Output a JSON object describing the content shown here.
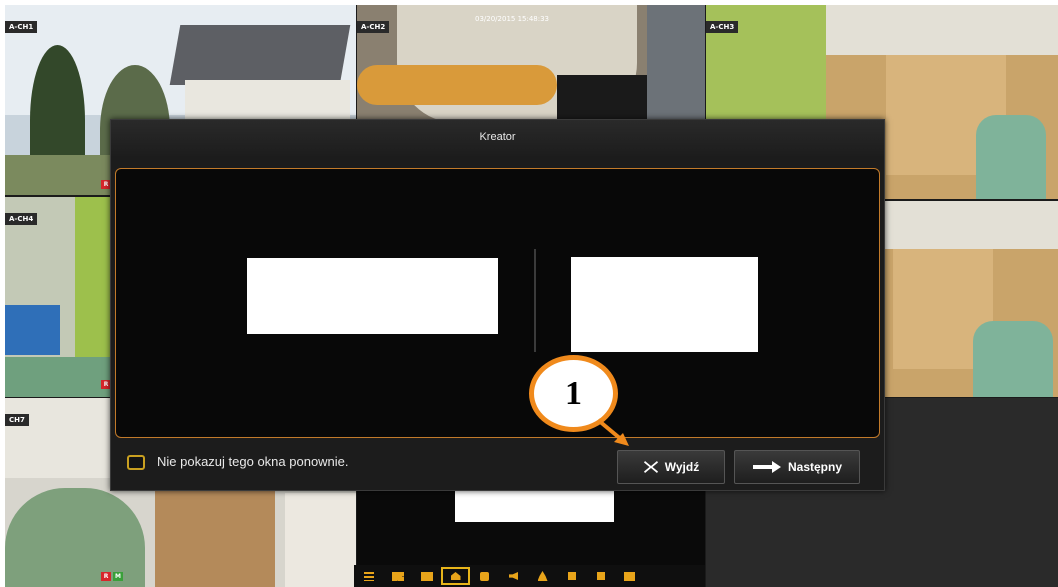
{
  "cameras": [
    {
      "id": "ch1",
      "label": "A-CH1"
    },
    {
      "id": "ch2",
      "label": "A-CH2"
    },
    {
      "id": "ch3",
      "label": "A-CH3"
    },
    {
      "id": "ch4",
      "label": "A-CH4"
    },
    {
      "id": "ch7",
      "label": "CH7"
    }
  ],
  "timestamp": "03/20/2015 15:48:33",
  "record_flags": {
    "r": "R",
    "m": "M"
  },
  "dialog": {
    "title": "Kreator",
    "dont_show_label": "Nie pokazuj tego okna ponownie.",
    "exit_label": "Wyjdź",
    "next_label": "Następny"
  },
  "callout": {
    "number": "1"
  },
  "colors": {
    "accent_orange": "#f08a1c",
    "dialog_border": "#c27a2a",
    "checkbox_border": "#c9a020",
    "taskbar_icon": "#e8a41a"
  },
  "taskbar": {
    "icons": [
      "menu-icon",
      "layout-4-icon",
      "layout-9-icon",
      "home-icon",
      "capture-icon",
      "audio-icon",
      "ptz-icon",
      "record-icon",
      "playback-icon",
      "sequence-icon"
    ]
  }
}
